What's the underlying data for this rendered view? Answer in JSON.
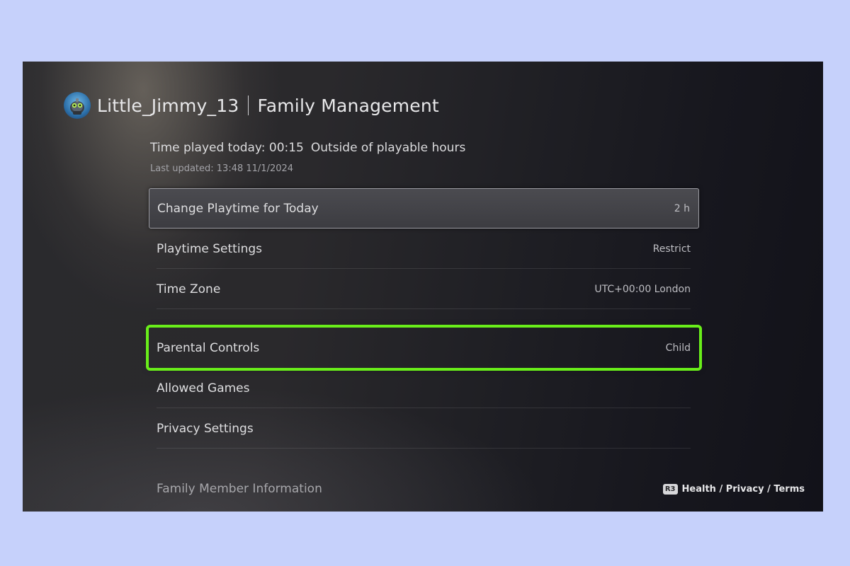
{
  "header": {
    "username": "Little_Jimmy_13",
    "title": "Family Management",
    "avatar_icon": "robot-avatar-icon"
  },
  "status": {
    "time_played_label": "Time played today: 00:15",
    "playable_state": "Outside of playable hours",
    "last_updated": "Last updated: 13:48 11/1/2024"
  },
  "menu": {
    "items": [
      {
        "label": "Change Playtime for Today",
        "value": "2 h"
      },
      {
        "label": "Playtime Settings",
        "value": "Restrict"
      },
      {
        "label": "Time Zone",
        "value": "UTC+00:00 London"
      },
      {
        "label": "Parental Controls",
        "value": "Child"
      },
      {
        "label": "Allowed Games",
        "value": ""
      },
      {
        "label": "Privacy Settings",
        "value": ""
      },
      {
        "label": "Family Member Information",
        "value": ""
      }
    ]
  },
  "footer": {
    "button_badge": "R3",
    "hint": "Health / Privacy / Terms"
  },
  "colors": {
    "highlight_outline": "#69ee1a",
    "page_background": "#c6d1fb"
  }
}
